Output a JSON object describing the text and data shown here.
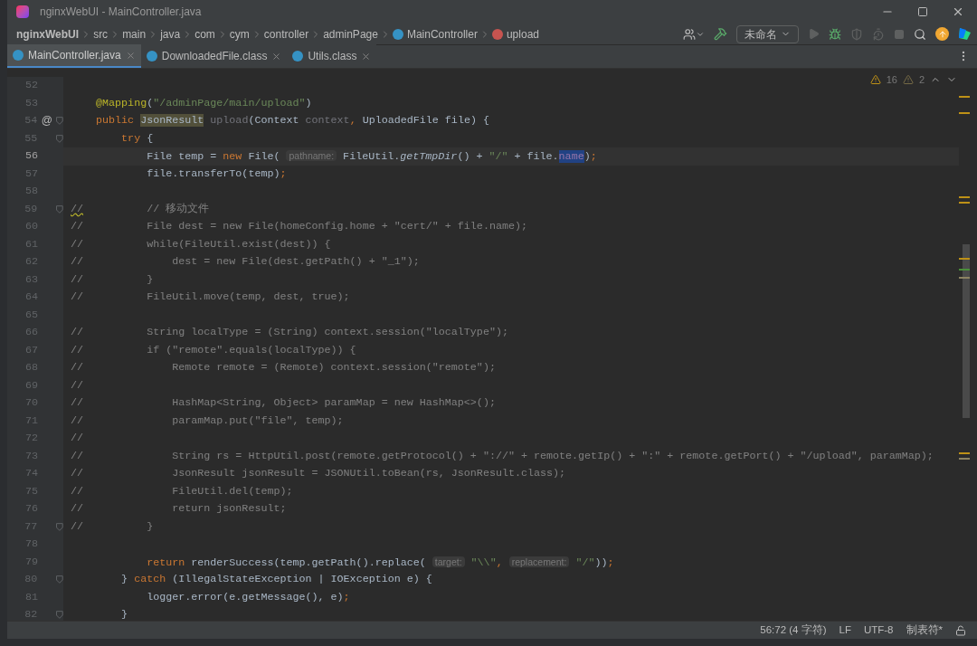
{
  "window": {
    "title": "nginxWebUI - MainController.java"
  },
  "breadcrumb": [
    {
      "kind": "project",
      "label": "nginxWebUI"
    },
    {
      "kind": "folder",
      "label": "src"
    },
    {
      "kind": "folder",
      "label": "main"
    },
    {
      "kind": "folder",
      "label": "java"
    },
    {
      "kind": "folder",
      "label": "com"
    },
    {
      "kind": "folder",
      "label": "cym"
    },
    {
      "kind": "folder",
      "label": "controller"
    },
    {
      "kind": "folder",
      "label": "adminPage"
    },
    {
      "kind": "class",
      "label": "MainController"
    },
    {
      "kind": "method",
      "label": "upload"
    }
  ],
  "run_config": {
    "label": "未命名"
  },
  "tabs": [
    {
      "label": "MainController.java",
      "selected": true
    },
    {
      "label": "DownloadedFile.class",
      "selected": false
    },
    {
      "label": "Utils.class",
      "selected": false
    }
  ],
  "inspections": {
    "warnings": "16",
    "weak_warnings": "2"
  },
  "lines": [
    {
      "number": "52",
      "current": false,
      "fold": false
    },
    {
      "number": "53",
      "current": false,
      "fold": false,
      "tokens": [
        {
          "kind": "annotation",
          "text": "    @Mapping"
        },
        {
          "kind": "plain",
          "text": "("
        },
        {
          "kind": "string",
          "text": "\"/adminPage/main/upload\""
        },
        {
          "kind": "plain",
          "text": ")"
        }
      ]
    },
    {
      "number": "54",
      "current": false,
      "fold": true,
      "gutter_mark": "@",
      "tokens": [
        {
          "kind": "keyword",
          "text": "    public "
        },
        {
          "kind": "usage",
          "text": "JsonResult"
        },
        {
          "kind": "unused",
          "text": " upload"
        },
        {
          "kind": "plain",
          "text": "(Context "
        },
        {
          "kind": "unused",
          "text": "context"
        },
        {
          "kind": "keyword",
          "text": ", "
        },
        {
          "kind": "plain",
          "text": "UploadedFile file) {"
        }
      ]
    },
    {
      "number": "55",
      "current": false,
      "fold": true,
      "tokens": [
        {
          "kind": "keyword",
          "text": "        try"
        },
        {
          "kind": "plain",
          "text": " {"
        }
      ]
    },
    {
      "number": "56",
      "current": true,
      "fold": false,
      "tokens": [
        {
          "kind": "plain",
          "text": "            File temp = "
        },
        {
          "kind": "keyword",
          "text": "new "
        },
        {
          "kind": "plain",
          "text": "File( "
        },
        {
          "kind": "hint",
          "text": "pathname:"
        },
        {
          "kind": "plain",
          "text": " FileUtil."
        },
        {
          "kind": "italic",
          "text": "getTmpDir"
        },
        {
          "kind": "plain",
          "text": "() + "
        },
        {
          "kind": "string",
          "text": "\"/\""
        },
        {
          "kind": "plain",
          "text": " + file."
        },
        {
          "kind": "selected",
          "text": "name"
        },
        {
          "kind": "plain",
          "text": ")"
        },
        {
          "kind": "keyword",
          "text": ";"
        }
      ]
    },
    {
      "number": "57",
      "current": false,
      "fold": false,
      "tokens": [
        {
          "kind": "plain",
          "text": "            file.transferTo(temp)"
        },
        {
          "kind": "keyword",
          "text": ";"
        }
      ]
    },
    {
      "number": "58",
      "current": false,
      "fold": false
    },
    {
      "number": "59",
      "current": false,
      "fold": true,
      "tokens": [
        {
          "kind": "comment_warn",
          "text": "//"
        },
        {
          "kind": "comment",
          "text": "          // 移动文件"
        }
      ]
    },
    {
      "number": "60",
      "current": false,
      "fold": false,
      "tokens": [
        {
          "kind": "comment",
          "text": "//          File dest = new File(homeConfig.home + \"cert/\" + file.name);"
        }
      ]
    },
    {
      "number": "61",
      "current": false,
      "fold": false,
      "tokens": [
        {
          "kind": "comment",
          "text": "//          while(FileUtil.exist(dest)) {"
        }
      ]
    },
    {
      "number": "62",
      "current": false,
      "fold": false,
      "tokens": [
        {
          "kind": "comment",
          "text": "//              dest = new File(dest.getPath() + \"_1\");"
        }
      ]
    },
    {
      "number": "63",
      "current": false,
      "fold": false,
      "tokens": [
        {
          "kind": "comment",
          "text": "//          }"
        }
      ]
    },
    {
      "number": "64",
      "current": false,
      "fold": false,
      "tokens": [
        {
          "kind": "comment",
          "text": "//          FileUtil.move(temp, dest, true);"
        }
      ]
    },
    {
      "number": "65",
      "current": false,
      "fold": false
    },
    {
      "number": "66",
      "current": false,
      "fold": false,
      "tokens": [
        {
          "kind": "comment",
          "text": "//          String localType = (String) context.session(\"localType\");"
        }
      ]
    },
    {
      "number": "67",
      "current": false,
      "fold": false,
      "tokens": [
        {
          "kind": "comment",
          "text": "//          if (\"remote\".equals(localType)) {"
        }
      ]
    },
    {
      "number": "68",
      "current": false,
      "fold": false,
      "tokens": [
        {
          "kind": "comment",
          "text": "//              Remote remote = (Remote) context.session(\"remote\");"
        }
      ]
    },
    {
      "number": "69",
      "current": false,
      "fold": false,
      "tokens": [
        {
          "kind": "comment",
          "text": "//"
        }
      ]
    },
    {
      "number": "70",
      "current": false,
      "fold": false,
      "tokens": [
        {
          "kind": "comment",
          "text": "//              HashMap<String, Object> paramMap = new HashMap<>();"
        }
      ]
    },
    {
      "number": "71",
      "current": false,
      "fold": false,
      "tokens": [
        {
          "kind": "comment",
          "text": "//              paramMap.put(\"file\", temp);"
        }
      ]
    },
    {
      "number": "72",
      "current": false,
      "fold": false,
      "tokens": [
        {
          "kind": "comment",
          "text": "//"
        }
      ]
    },
    {
      "number": "73",
      "current": false,
      "fold": false,
      "tokens": [
        {
          "kind": "comment",
          "text": "//              String rs = HttpUtil.post(remote.getProtocol() + \"://\" + remote.getIp() + \":\" + remote.getPort() + \"/upload\", paramMap);"
        }
      ]
    },
    {
      "number": "74",
      "current": false,
      "fold": false,
      "tokens": [
        {
          "kind": "comment",
          "text": "//              JsonResult jsonResult = JSONUtil.toBean(rs, JsonResult.class);"
        }
      ]
    },
    {
      "number": "75",
      "current": false,
      "fold": false,
      "tokens": [
        {
          "kind": "comment",
          "text": "//              FileUtil.del(temp);"
        }
      ]
    },
    {
      "number": "76",
      "current": false,
      "fold": false,
      "tokens": [
        {
          "kind": "comment",
          "text": "//              return jsonResult;"
        }
      ]
    },
    {
      "number": "77",
      "current": false,
      "fold": true,
      "tokens": [
        {
          "kind": "comment",
          "text": "//          }"
        }
      ]
    },
    {
      "number": "78",
      "current": false,
      "fold": false
    },
    {
      "number": "79",
      "current": false,
      "fold": false,
      "tokens": [
        {
          "kind": "keyword",
          "text": "            return "
        },
        {
          "kind": "plain",
          "text": "renderSuccess(temp.getPath().replace( "
        },
        {
          "kind": "hint",
          "text": "target:"
        },
        {
          "kind": "string",
          "text": " \"\\\\\""
        },
        {
          "kind": "keyword",
          "text": ", "
        },
        {
          "kind": "hint",
          "text": "replacement:"
        },
        {
          "kind": "string",
          "text": " \"/\""
        },
        {
          "kind": "plain",
          "text": "))"
        },
        {
          "kind": "keyword",
          "text": ";"
        }
      ]
    },
    {
      "number": "80",
      "current": false,
      "fold": true,
      "tokens": [
        {
          "kind": "plain",
          "text": "        } "
        },
        {
          "kind": "keyword",
          "text": "catch"
        },
        {
          "kind": "plain",
          "text": " (IllegalStateException | IOException e) {"
        }
      ]
    },
    {
      "number": "81",
      "current": false,
      "fold": false,
      "tokens": [
        {
          "kind": "plain",
          "text": "            logger.error(e.getMessage(), e)"
        },
        {
          "kind": "keyword",
          "text": ";"
        }
      ]
    },
    {
      "number": "82",
      "current": false,
      "fold": true,
      "tokens": [
        {
          "kind": "plain",
          "text": "        }"
        }
      ]
    }
  ],
  "status_bar": {
    "position": "56:72 (4 字符)",
    "line_separator": "LF",
    "encoding": "UTF-8",
    "indent": "制表符*"
  }
}
